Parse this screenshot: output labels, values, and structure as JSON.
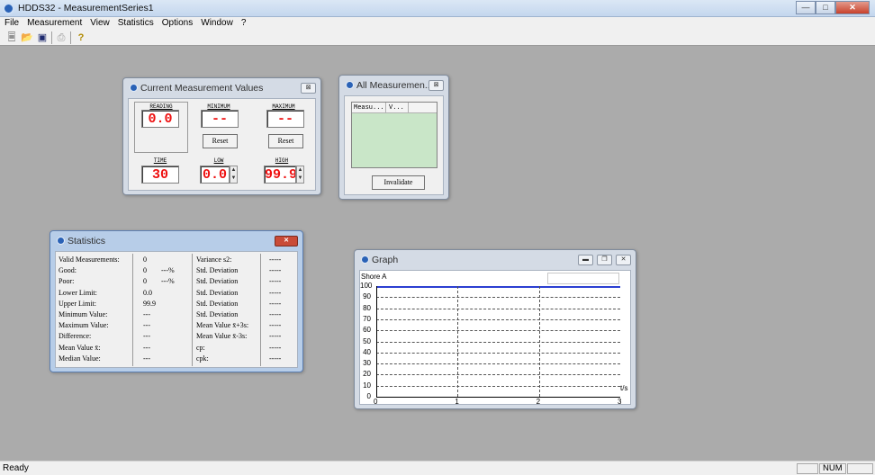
{
  "app": {
    "title": "HDDS32 - MeasurementSeries1"
  },
  "menu": [
    "File",
    "Measurement",
    "View",
    "Statistics",
    "Options",
    "Window",
    "?"
  ],
  "toolbar": {
    "icons": [
      "new-icon",
      "open-icon",
      "save-icon",
      "print-icon",
      "help-icon"
    ]
  },
  "status": {
    "text": "Ready",
    "num": "NUM"
  },
  "current": {
    "title": "Current Measurement Values",
    "close": "⊠",
    "reading_label": "READING",
    "reading_value": "0.0",
    "minimum_label": "MINIMUM",
    "minimum_value": "---.-",
    "maximum_label": "MAXIMUM",
    "maximum_value": "---.-",
    "reset_label": "Reset",
    "time_label": "TIME",
    "time_value": "30",
    "low_label": "LOW",
    "low_value": "0.0",
    "high_label": "HIGH",
    "high_value": "99.9"
  },
  "all": {
    "title": "All Measuremen...",
    "close": "⊠",
    "columns": [
      "Measu...",
      "V..."
    ],
    "invalidate": "Invalidate"
  },
  "stats": {
    "title": "Statistics",
    "left_rows": [
      {
        "label": "Valid Measurements:",
        "value": "0",
        "pct": ""
      },
      {
        "label": "Good:",
        "value": "0",
        "pct": "---%"
      },
      {
        "label": "Poor:",
        "value": "0",
        "pct": "---%"
      },
      {
        "label": "Lower Limit:",
        "value": "0.0",
        "pct": ""
      },
      {
        "label": "Upper Limit:",
        "value": "99.9",
        "pct": ""
      },
      {
        "label": "Minimum Value:",
        "value": "---",
        "pct": ""
      },
      {
        "label": "Maximum Value:",
        "value": "---",
        "pct": ""
      },
      {
        "label": "Difference:",
        "value": "---",
        "pct": ""
      },
      {
        "label": "Mean Value x̄:",
        "value": "---",
        "pct": ""
      },
      {
        "label": "Median Value:",
        "value": "---",
        "pct": ""
      }
    ],
    "right_rows": [
      {
        "label": "Variance s2:",
        "value": "-----"
      },
      {
        "label": "Std. Deviation",
        "value": "-----"
      },
      {
        "label": "Std. Deviation",
        "value": "-----"
      },
      {
        "label": "Std. Deviation",
        "value": "-----"
      },
      {
        "label": "Std. Deviation",
        "value": "-----"
      },
      {
        "label": "Std. Deviation",
        "value": "-----"
      },
      {
        "label": "Mean Value x̄+3s:",
        "value": "-----"
      },
      {
        "label": "Mean Value x̄-3s:",
        "value": "-----"
      },
      {
        "label": "cp:",
        "value": "-----"
      },
      {
        "label": "cpk:",
        "value": "-----"
      }
    ]
  },
  "graph": {
    "title": "Graph",
    "label": "Shore A",
    "y_ticks": [
      "100",
      "90",
      "80",
      "70",
      "60",
      "50",
      "40",
      "30",
      "20",
      "10",
      "0"
    ],
    "x_ticks": [
      "0",
      "1",
      "2",
      "3"
    ],
    "x_unit": "t/s",
    "colors": {
      "limit_line": "#2b3fd1"
    }
  }
}
